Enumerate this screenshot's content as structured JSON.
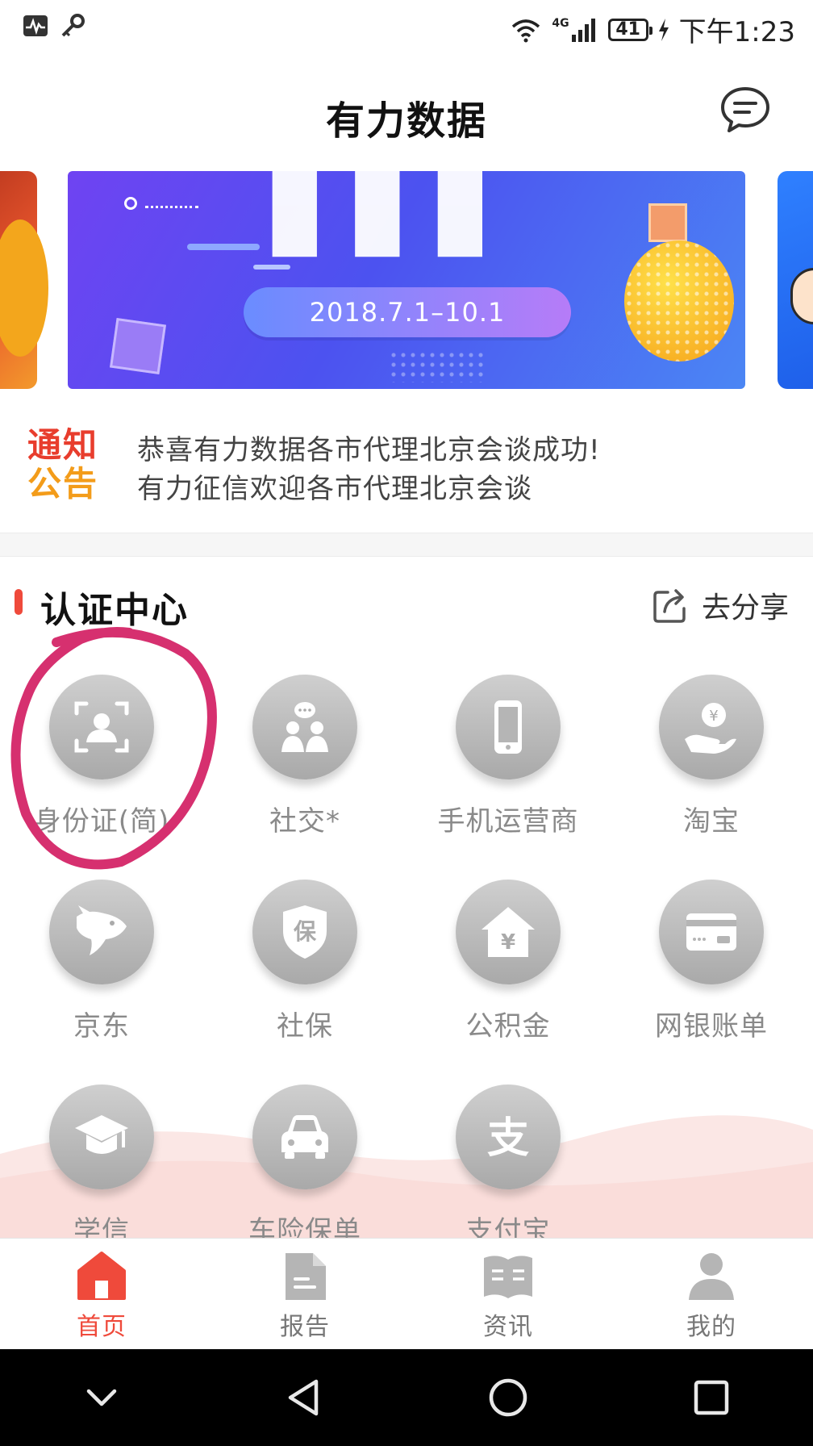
{
  "status_bar": {
    "network": "4G",
    "battery": "41",
    "time": "下午1:23"
  },
  "header": {
    "title": "有力数据",
    "message_icon": "chat-bubble-icon"
  },
  "banner": {
    "date_range": "2018.7.1–10.1"
  },
  "notice": {
    "badge_line1": "通知",
    "badge_line2": "公告",
    "lines": [
      "恭喜有力数据各市代理北京会谈成功!",
      "有力征信欢迎各市代理北京会谈"
    ]
  },
  "section": {
    "title": "认证中心",
    "share_label": "去分享",
    "accent": "#ef4a3b"
  },
  "grid": {
    "items": [
      {
        "label": "身份证(简)",
        "icon": "id-card-icon"
      },
      {
        "label": "社交*",
        "icon": "social-people-icon"
      },
      {
        "label": "手机运营商",
        "icon": "mobile-phone-icon"
      },
      {
        "label": "淘宝",
        "icon": "hand-coin-icon"
      },
      {
        "label": "京东",
        "icon": "jd-dog-icon"
      },
      {
        "label": "社保",
        "icon": "shield-bao-icon"
      },
      {
        "label": "公积金",
        "icon": "house-yuan-icon"
      },
      {
        "label": "网银账单",
        "icon": "bank-card-icon"
      },
      {
        "label": "学信",
        "icon": "graduation-cap-icon"
      },
      {
        "label": "车险保单",
        "icon": "car-icon"
      },
      {
        "label": "支付宝",
        "icon": "alipay-icon"
      }
    ]
  },
  "annotation": {
    "color": "#d6306f"
  },
  "bottom_nav": {
    "items": [
      {
        "label": "首页",
        "icon": "home-icon",
        "active": true
      },
      {
        "label": "报告",
        "icon": "report-document-icon",
        "active": false
      },
      {
        "label": "资讯",
        "icon": "news-book-icon",
        "active": false
      },
      {
        "label": "我的",
        "icon": "user-profile-icon",
        "active": false
      }
    ],
    "active_color": "#ef4a3b",
    "inactive_color": "#b5b5b5"
  },
  "system_nav": {
    "buttons": [
      "collapse-chevron-icon",
      "back-triangle-icon",
      "home-circle-icon",
      "recents-square-icon"
    ]
  }
}
